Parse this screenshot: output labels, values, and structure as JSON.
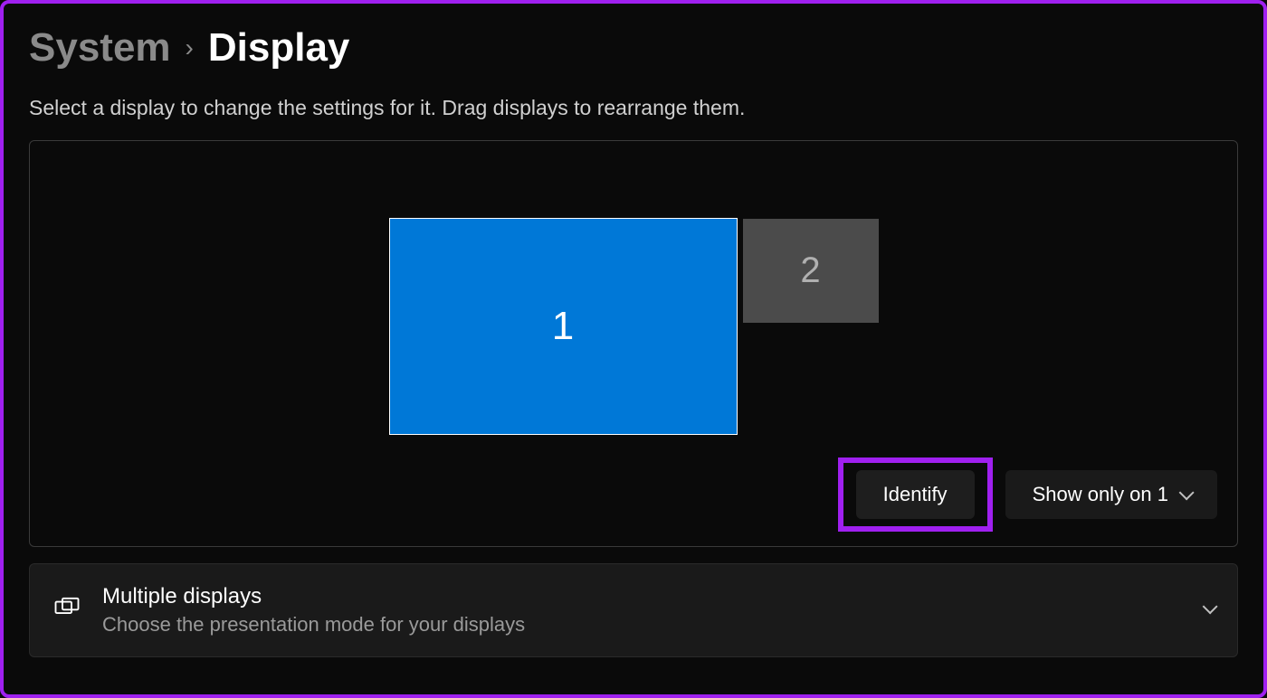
{
  "breadcrumb": {
    "parent": "System",
    "current": "Display"
  },
  "instructions": "Select a display to change the settings for it. Drag displays to rearrange them.",
  "displays": {
    "monitor1": "1",
    "monitor2": "2"
  },
  "buttons": {
    "identify": "Identify",
    "show_option": "Show only on 1"
  },
  "multiple_displays": {
    "title": "Multiple displays",
    "subtitle": "Choose the presentation mode for your displays"
  }
}
